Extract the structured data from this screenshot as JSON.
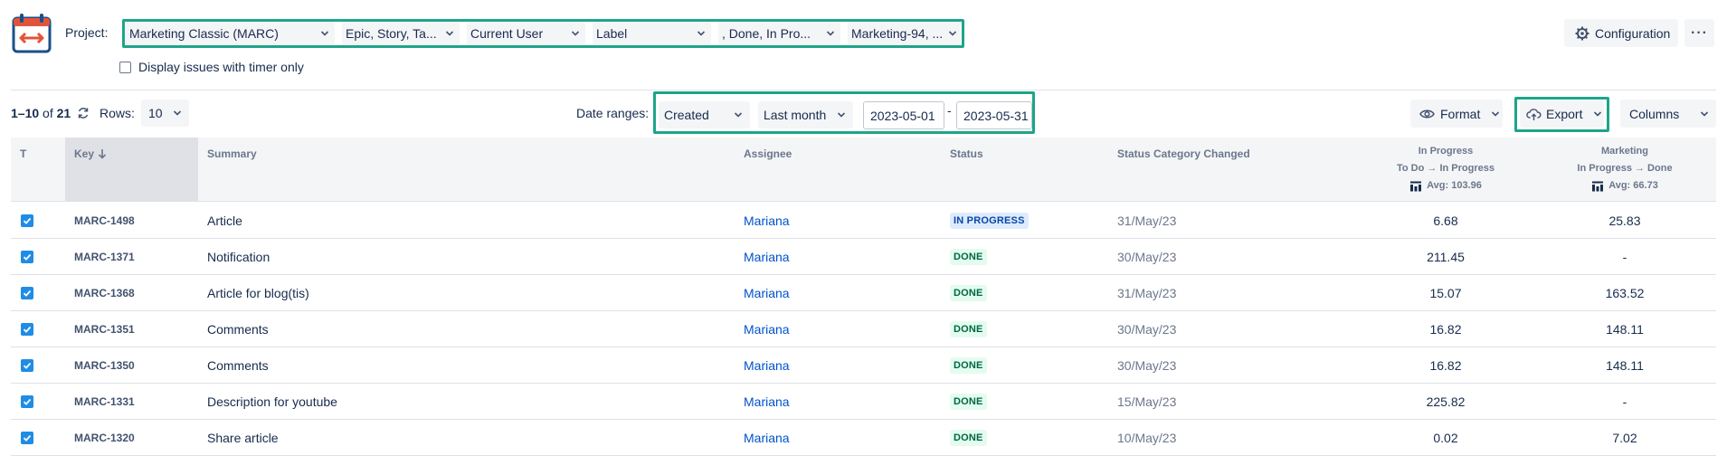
{
  "header": {
    "project_label": "Project:",
    "filters": [
      {
        "name": "project",
        "value": "Marketing Classic (MARC)"
      },
      {
        "name": "issue-types",
        "value": "Epic, Story, Ta..."
      },
      {
        "name": "user",
        "value": "Current User"
      },
      {
        "name": "label",
        "value": "Label"
      },
      {
        "name": "statuses",
        "value": ", Done, In Pro..."
      },
      {
        "name": "sprints",
        "value": "Marketing-94, ..."
      }
    ],
    "configuration_label": "Configuration",
    "more_label": "···",
    "timer_only_label": "Display issues with timer only"
  },
  "toolbar": {
    "range_prefix": "1–10",
    "range_of": " of ",
    "range_total": "21",
    "rows_label": "Rows:",
    "rows_value": "10",
    "date_ranges_label": "Date ranges:",
    "date_field": "Created",
    "date_period": "Last month",
    "date_from": "2023-05-01",
    "date_sep": "-",
    "date_to": "2023-05-31",
    "format_label": "Format",
    "export_label": "Export",
    "columns_label": "Columns"
  },
  "table": {
    "headers": {
      "type": "T",
      "key": "Key",
      "summary": "Summary",
      "assignee": "Assignee",
      "status": "Status",
      "status_changed": "Status Category Changed",
      "col1_title": "In Progress",
      "col1_transition": "To Do → In Progress",
      "col1_avg": "Avg: 103.96",
      "col2_title": "Marketing",
      "col2_transition": "In Progress → Done",
      "col2_avg": "Avg: 66.73"
    },
    "rows": [
      {
        "key": "MARC-1498",
        "summary": "Article",
        "assignee": "Mariana",
        "status": "IN PROGRESS",
        "status_kind": "progress",
        "changed": "31/May/23",
        "c1": "6.68",
        "c2": "25.83"
      },
      {
        "key": "MARC-1371",
        "summary": "Notification",
        "assignee": "Mariana",
        "status": "DONE",
        "status_kind": "done",
        "changed": "30/May/23",
        "c1": "211.45",
        "c2": "-"
      },
      {
        "key": "MARC-1368",
        "summary": "Article for blog(tis)",
        "assignee": "Mariana",
        "status": "DONE",
        "status_kind": "done",
        "changed": "31/May/23",
        "c1": "15.07",
        "c2": "163.52"
      },
      {
        "key": "MARC-1351",
        "summary": "Comments",
        "assignee": "Mariana",
        "status": "DONE",
        "status_kind": "done",
        "changed": "30/May/23",
        "c1": "16.82",
        "c2": "148.11"
      },
      {
        "key": "MARC-1350",
        "summary": "Comments",
        "assignee": "Mariana",
        "status": "DONE",
        "status_kind": "done",
        "changed": "30/May/23",
        "c1": "16.82",
        "c2": "148.11"
      },
      {
        "key": "MARC-1331",
        "summary": "Description for youtube",
        "assignee": "Mariana",
        "status": "DONE",
        "status_kind": "done",
        "changed": "15/May/23",
        "c1": "225.82",
        "c2": "-"
      },
      {
        "key": "MARC-1320",
        "summary": "Share article",
        "assignee": "Mariana",
        "status": "DONE",
        "status_kind": "done",
        "changed": "10/May/23",
        "c1": "0.02",
        "c2": "7.02"
      }
    ]
  },
  "colors": {
    "highlight_border": "#1da589",
    "logo_accent": "#e0553a",
    "logo_frame": "#1b4f8a",
    "checkbox": "#1f8ce6",
    "link": "#0052cc"
  }
}
